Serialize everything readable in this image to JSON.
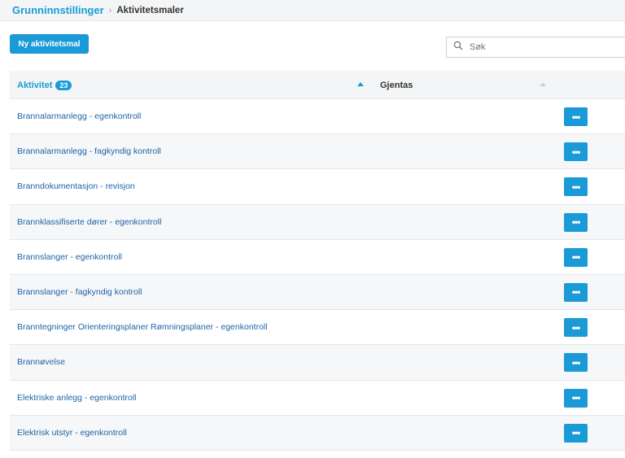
{
  "breadcrumb": {
    "root": "Grunninnstillinger",
    "separator": "›",
    "current": "Aktivitetsmaler"
  },
  "toolbar": {
    "new_label": "Ny aktivitetsmal"
  },
  "search": {
    "placeholder": "Søk",
    "icon": "search-icon"
  },
  "table": {
    "columns": {
      "activity": "Aktivitet",
      "activity_count": "23",
      "repeats": "Gjentas"
    },
    "rows": [
      {
        "label": "Brannalarmanlegg - egenkontroll",
        "action": "•••"
      },
      {
        "label": "Brannalarmanlegg - fagkyndig kontroll",
        "action": "•••"
      },
      {
        "label": "Branndokumentasjon - revisjon",
        "action": "•••"
      },
      {
        "label": "Brannklassifiserte dører - egenkontroll",
        "action": "•••"
      },
      {
        "label": "Brannslanger - egenkontroll",
        "action": "•••"
      },
      {
        "label": "Brannslanger - fagkyndig kontroll",
        "action": "•••"
      },
      {
        "label": "Branntegninger Orienteringsplaner Rømningsplaner - egenkontroll",
        "action": "•••"
      },
      {
        "label": "Brannøvelse",
        "action": "•••"
      },
      {
        "label": "Elektriske anlegg - egenkontroll",
        "action": "•••"
      },
      {
        "label": "Elektrisk utstyr - egenkontroll",
        "action": "•••"
      }
    ]
  },
  "colors": {
    "accent": "#1a9bd7",
    "link": "#1e63a8",
    "header_bg": "#f4f5f6"
  }
}
